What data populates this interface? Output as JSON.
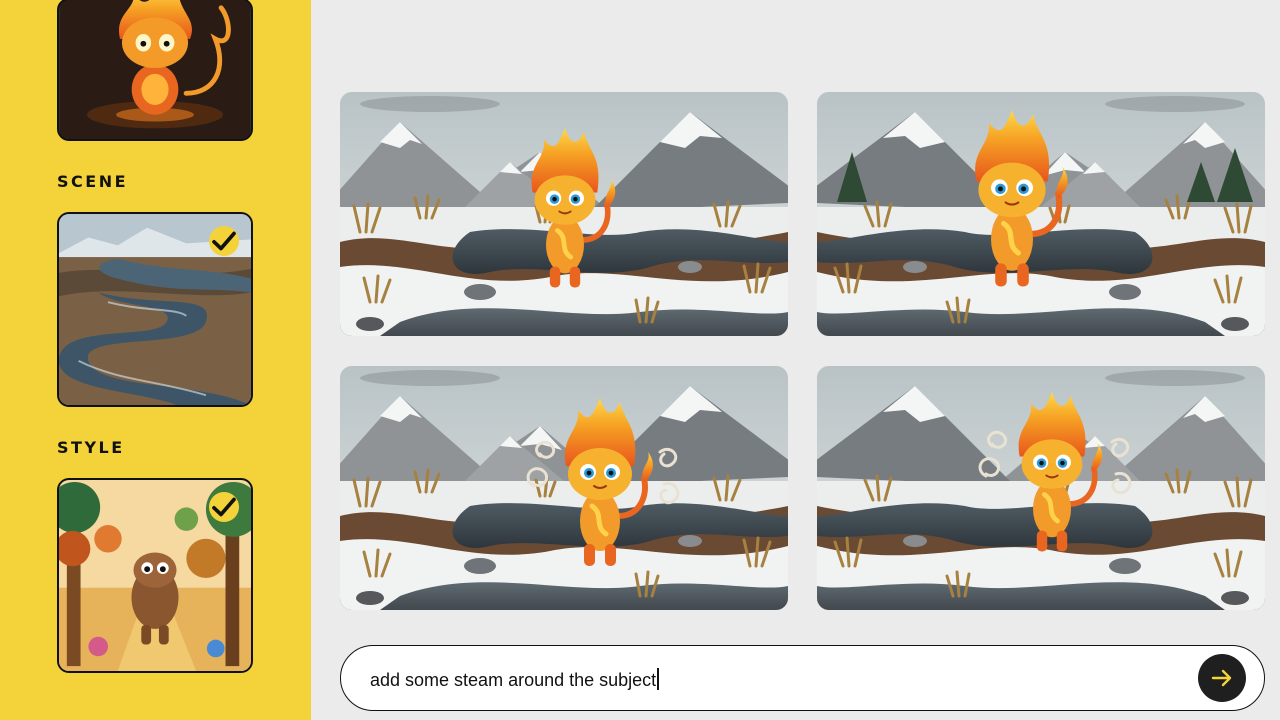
{
  "sidebar": {
    "scene_label": "SCENE",
    "style_label": "STYLE",
    "subject_thumb_icon": "fire-creature-image",
    "scene_thumb_icon": "frozen-river-landscape-image",
    "style_thumb_icon": "clay-forest-creature-image",
    "scene_selected": true,
    "style_selected": true
  },
  "results": [
    {
      "icon": "fire-creature-snowy-marsh-image"
    },
    {
      "icon": "fire-creature-snowy-marsh-image"
    },
    {
      "icon": "fire-creature-steam-image"
    },
    {
      "icon": "fire-creature-steam-image"
    }
  ],
  "prompt": {
    "value": "add some steam around the subject",
    "send_icon": "arrow-right-icon"
  },
  "colors": {
    "accent": "#f3d23a",
    "background": "#ebebeb",
    "send_button": "#1f1f1f"
  }
}
